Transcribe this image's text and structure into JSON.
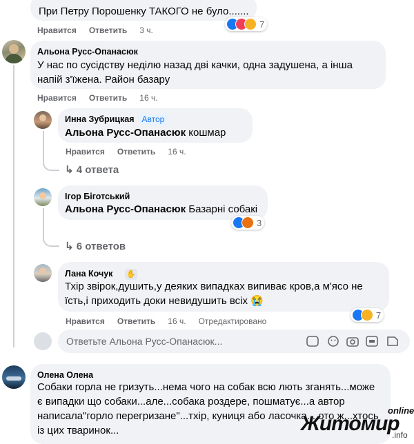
{
  "comments": [
    {
      "text": "При Петру Порошенку ТАКОГО не було.......",
      "actions": {
        "like": "Нравится",
        "reply": "Ответить",
        "time": "3 ч."
      },
      "reactions": {
        "count": "7",
        "icons": [
          "like-icon",
          "love-icon",
          "haha-icon"
        ]
      }
    },
    {
      "author": "Альона Русс-Опанасюк",
      "text": "У нас по сусідству неділю назад дві качки, одна задушена, а інша напій з'їжена. Район базару",
      "actions": {
        "like": "Нравится",
        "reply": "Ответить",
        "time": "16 ч."
      }
    },
    {
      "author": "Олена Олена",
      "text": "Собаки горла не гризуть...нема чого на собак всю лють зганять...може є випадки що собаки...але...собака роздере, пошматує...а автор написала\"горло перегризане\"...тхір, куниця або ласочка....ото ж...хтось із цих тваринок..."
    }
  ],
  "replies": [
    {
      "author": "Инна Зубрицкая",
      "badge": "Автор",
      "mention": "Альона Русс-Опанасюк",
      "text": "кошмар",
      "actions": {
        "like": "Нравится",
        "reply": "Ответить",
        "time": "16 ч."
      },
      "more_replies": "4 ответа"
    },
    {
      "author": "Ігор Біготський",
      "mention": "Альона Русс-Опанасюк",
      "text": "Базарні собакі",
      "actions": {
        "like": "Нравится",
        "reply": "Ответить",
        "time": "16 ч."
      },
      "reactions": {
        "count": "3",
        "icons": [
          "like-icon",
          "angry-icon"
        ]
      },
      "more_replies": "6 ответов"
    },
    {
      "author": "Лана Кочук",
      "text": "Тхір звірок,душить,у деяких випадках випиває кров,а м'ясо не їсть,і приходить доки невидушить всіх 😭",
      "actions": {
        "like": "Нравится",
        "reply": "Ответить",
        "time": "16 ч.",
        "edited": "Отредактировано"
      },
      "reactions": {
        "count": "7",
        "icons": [
          "like-icon",
          "wow-icon"
        ]
      }
    }
  ],
  "composer": {
    "placeholder": "Ответьте Альона Русс-Опанасюк...",
    "icons": [
      "sticker-icon",
      "emoji-icon",
      "camera-icon",
      "gif-icon",
      "sticker2-icon"
    ]
  },
  "watermark": {
    "brand_top": "online",
    "brand_main": "Житомир",
    "brand_suffix": ".info"
  },
  "colors": {
    "meta_gray": "#65676b",
    "bubble_bg": "#f0f2f5",
    "link_blue": "#1877f2",
    "thread_line": "#ccd0d5"
  }
}
